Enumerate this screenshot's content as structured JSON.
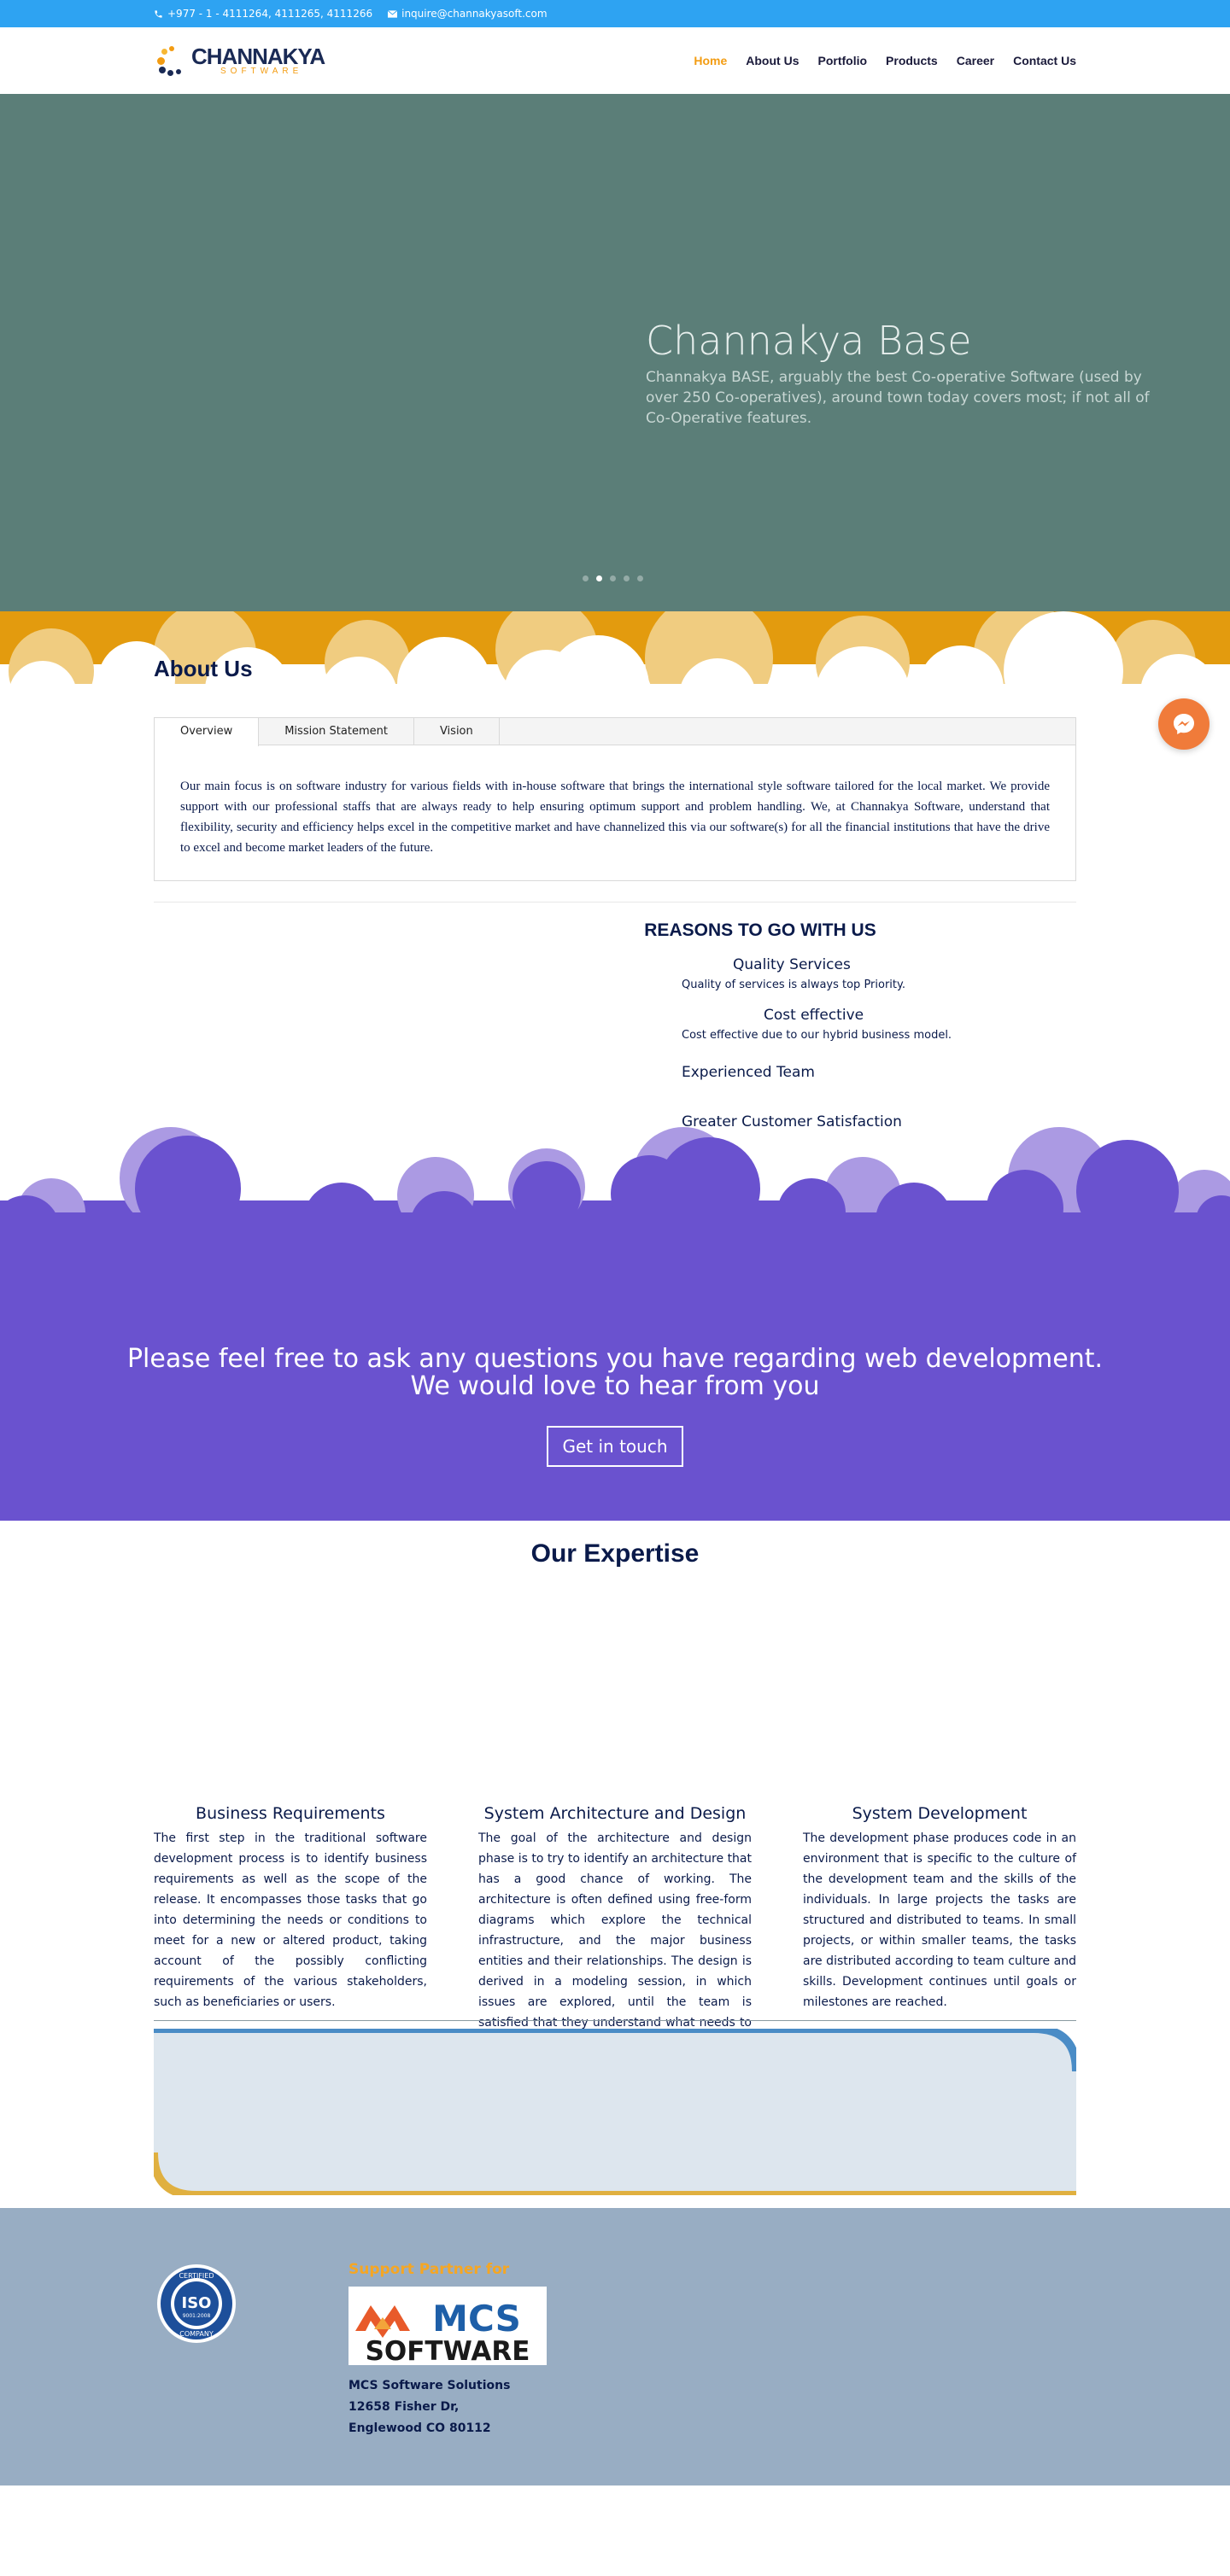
{
  "topbar": {
    "phone": "+977 - 1 - 4111264, 4111265, 4111266",
    "email": "inquire@channakyasoft.com"
  },
  "logo": {
    "brand": "CHANNAKYA",
    "sub": "SOFTWARE"
  },
  "nav": [
    {
      "label": "Home",
      "active": true
    },
    {
      "label": "About Us"
    },
    {
      "label": "Portfolio"
    },
    {
      "label": "Products"
    },
    {
      "label": "Career"
    },
    {
      "label": "Contact Us"
    }
  ],
  "hero": {
    "title": "Channakya Base",
    "description": "Channakya BASE, arguably the best Co-operative Software (used by over 250 Co-operatives), around town today covers most; if not all of Co-Operative features.",
    "slide_count": 5,
    "active_slide": 2
  },
  "about": {
    "title": "About Us",
    "tabs": [
      "Overview",
      "Mission Statement",
      "Vision"
    ],
    "active_tab": "Overview",
    "body": "Our main focus is on software industry for various fields with in-house software that brings the international style software tailored for the local market. We provide support with our professional staffs that are always ready to help ensuring optimum support and problem handling. We, at Channakya Software, understand that flexibility, security and efficiency helps excel in the competitive market and have channelized this via our software(s) for all the financial institutions that have the drive to excel and become market leaders of the future."
  },
  "reasons": {
    "title": "REASONS TO GO WITH US",
    "items": [
      {
        "title": "Quality Services",
        "text": "Quality of services is always top Priority."
      },
      {
        "title": "Cost effective",
        "text": "Cost effective due to our hybrid business model."
      },
      {
        "title": "Experienced Team",
        "text": ""
      },
      {
        "title": "Greater Customer Satisfaction",
        "text": ""
      }
    ]
  },
  "cta": {
    "line1": "Please feel free to ask any questions you have regarding web development.",
    "line2": "We would love to hear from you",
    "button": "Get in touch"
  },
  "expertise": {
    "title": "Our Expertise",
    "items": [
      {
        "title": "Business Requirements",
        "text": "The first step in the traditional software development process is to identify business requirements as well as the scope of the release. It encompasses those tasks that go into determining the needs or conditions to meet for a new or altered product, taking account of the possibly conflicting requirements of the various stakeholders, such as beneficiaries or users."
      },
      {
        "title": "System Architecture and Design",
        "text": "The goal of the architecture and design phase is to try to identify an architecture that has a good chance of working. The architecture is often defined using free-form diagrams which explore the technical infrastructure, and the major business entities and their relationships. The design is derived in a modeling session, in which issues are explored, until the team is satisfied that they understand what needs to be delivered."
      },
      {
        "title": "System Development",
        "text": "The development phase produces code in an environment that is specific to the culture of the development team and the skills of the individuals. In large projects the tasks are structured and distributed to teams. In small projects, or within smaller teams, the tasks are distributed according to team culture and skills. Development continues until goals or milestones are reached."
      }
    ]
  },
  "footer": {
    "iso": {
      "top": "CERTIFIED",
      "mid": "ISO",
      "num": "9001:2008",
      "bottom": "COMPANY"
    },
    "partner_title": "Support Partner for",
    "partner_logo": {
      "top": "MCS",
      "bottom": "SOFTWARE"
    },
    "address": [
      "MCS Software Solutions",
      "12658 Fisher Dr,",
      "Englewood CO 80112"
    ]
  },
  "colors": {
    "topbar": "#2ea3f2",
    "accent": "#f39c12",
    "hero_bg": "#5b7e78",
    "about_band": "#e39b0e",
    "cta_bg": "#6a52cf",
    "footer_bg": "#98adc3",
    "messenger": "#f07b3a"
  },
  "icons": [
    "phone-icon",
    "mail-icon",
    "messenger-icon"
  ]
}
